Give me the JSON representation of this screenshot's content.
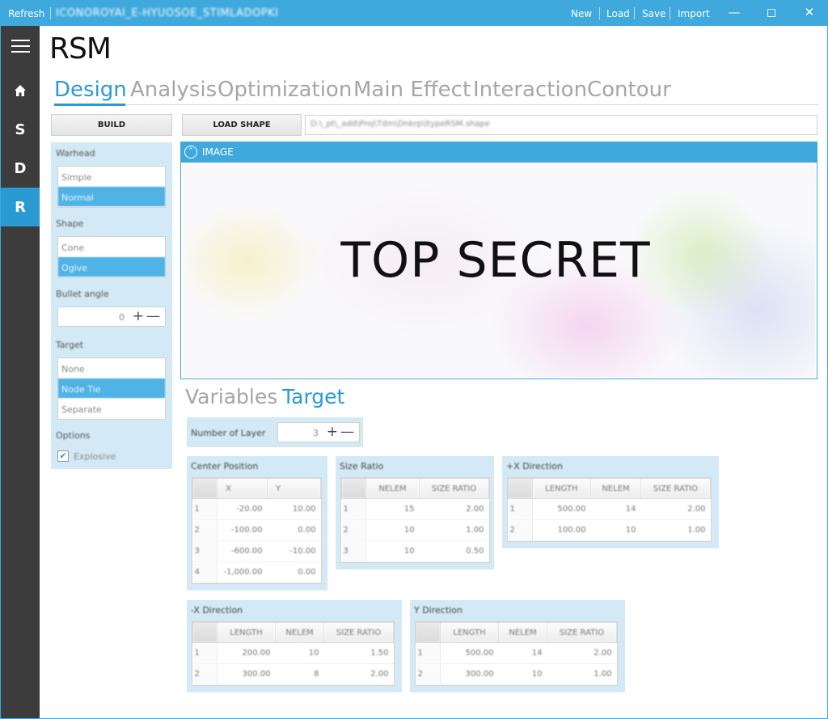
{
  "titlebar": {
    "refresh": "Refresh",
    "path": "ICONOROYAI_E-HYUOSOE_STIMLADOPKI",
    "menu": [
      "New",
      "Load",
      "Save",
      "Import"
    ]
  },
  "sidebar": {
    "items": [
      {
        "icon": "home-icon",
        "label": ""
      },
      {
        "label": "S"
      },
      {
        "label": "D"
      },
      {
        "label": "R",
        "active": true
      }
    ]
  },
  "app_title": "RSM",
  "tabs": [
    "Design",
    "Analysis",
    "Optimization",
    "Main Effect",
    "Interaction",
    "Contour"
  ],
  "build_label": "BUILD",
  "load_shape_label": "LOAD SHAPE",
  "shape_path": "D:\\_pt\\_add\\Proj\\Tdm\\Dnkrp\\ltypeRSM.shape",
  "options": {
    "warhead": {
      "label": "Warhead",
      "items": [
        "Simple",
        "Normal"
      ],
      "selected": "Normal"
    },
    "shape": {
      "label": "Shape",
      "items": [
        "Cone",
        "Ogive"
      ],
      "selected": "Ogive"
    },
    "bullet_angle": {
      "label": "Bullet angle",
      "value": "0"
    },
    "target": {
      "label": "Target",
      "items": [
        "None",
        "Node Tie",
        "Separate"
      ],
      "selected": "Node Tie"
    },
    "options_label": "Options",
    "explosive": {
      "label": "Explosive",
      "checked": true
    }
  },
  "image_panel": {
    "header": "IMAGE",
    "overlay_text": "TOP SECRET"
  },
  "subtabs": [
    "Variables",
    "Target"
  ],
  "layers": {
    "label": "Number of Layer",
    "value": "3"
  },
  "center_position": {
    "title": "Center Position",
    "columns": [
      "X",
      "Y"
    ],
    "rows": [
      {
        "idx": "1",
        "cells": [
          "-20.00",
          "10.00"
        ]
      },
      {
        "idx": "2",
        "cells": [
          "-100.00",
          "0.00"
        ]
      },
      {
        "idx": "3",
        "cells": [
          "-600.00",
          "-10.00"
        ]
      },
      {
        "idx": "4",
        "cells": [
          "-1,000.00",
          "0.00"
        ]
      }
    ]
  },
  "size_ratio": {
    "title": "Size Ratio",
    "columns": [
      "NELEM",
      "SIZE RATIO"
    ],
    "rows": [
      {
        "idx": "1",
        "cells": [
          "15",
          "2.00"
        ]
      },
      {
        "idx": "2",
        "cells": [
          "10",
          "1.00"
        ]
      },
      {
        "idx": "3",
        "cells": [
          "10",
          "0.50"
        ]
      }
    ]
  },
  "x_direction_pos": {
    "title": "+X Direction",
    "columns": [
      "LENGTH",
      "NELEM",
      "SIZE RATIO"
    ],
    "rows": [
      {
        "idx": "1",
        "cells": [
          "500.00",
          "14",
          "2.00"
        ]
      },
      {
        "idx": "2",
        "cells": [
          "100.00",
          "10",
          "1.00"
        ]
      }
    ]
  },
  "x_direction_neg": {
    "title": "-X Direction",
    "columns": [
      "LENGTH",
      "NELEM",
      "SIZE RATIO"
    ],
    "rows": [
      {
        "idx": "1",
        "cells": [
          "200.00",
          "10",
          "1.50"
        ]
      },
      {
        "idx": "2",
        "cells": [
          "300.00",
          "8",
          "2.00"
        ]
      }
    ]
  },
  "y_direction": {
    "title": "Y Direction",
    "columns": [
      "LENGTH",
      "NELEM",
      "SIZE RATIO"
    ],
    "rows": [
      {
        "idx": "1",
        "cells": [
          "500.00",
          "14",
          "2.00"
        ]
      },
      {
        "idx": "2",
        "cells": [
          "300.00",
          "10",
          "1.00"
        ]
      }
    ]
  }
}
